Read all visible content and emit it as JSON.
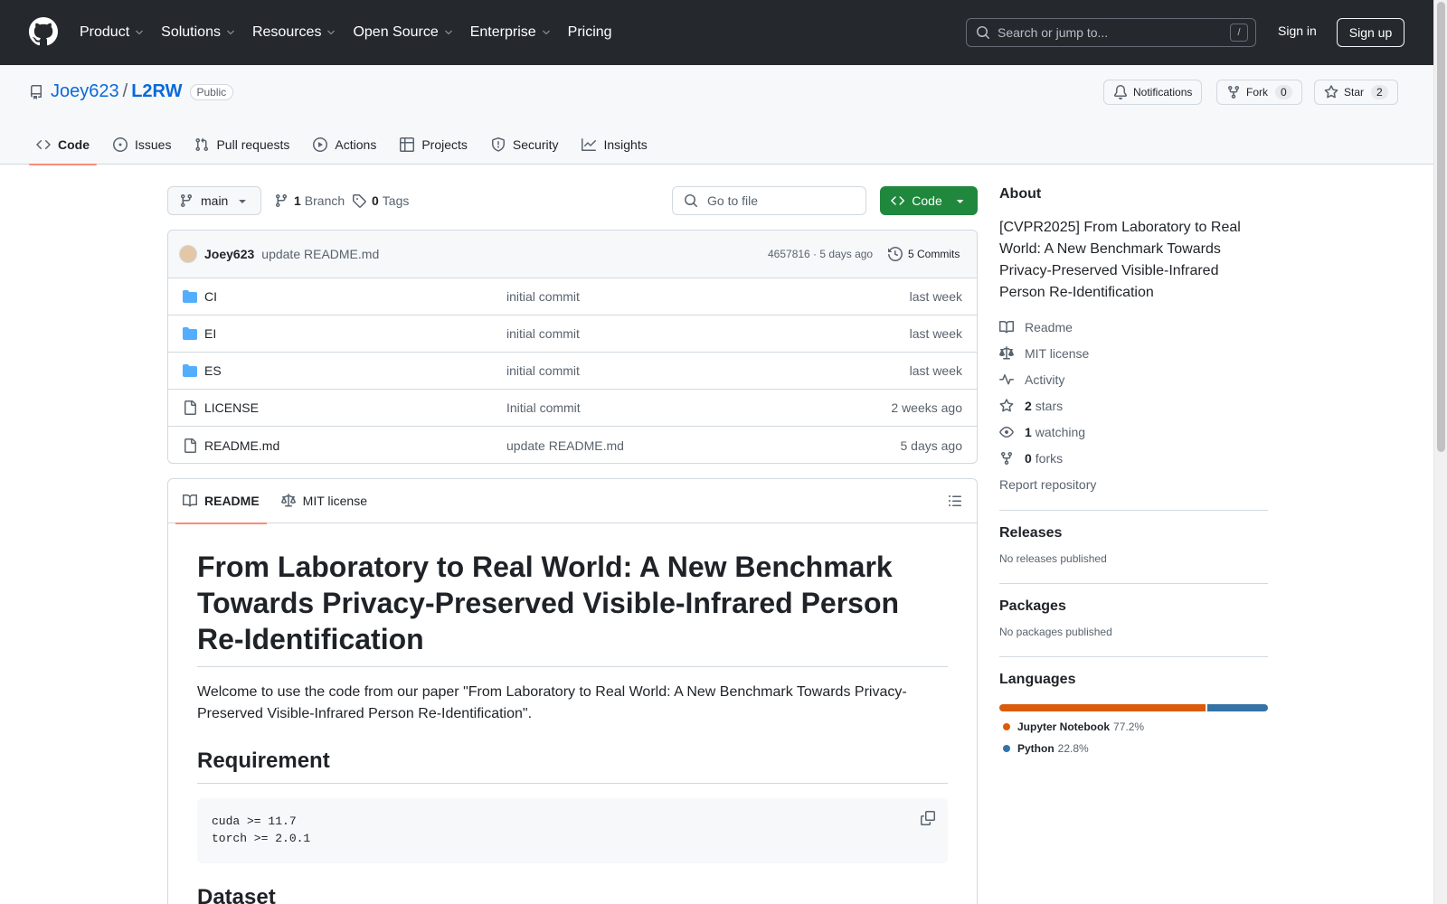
{
  "header": {
    "nav": [
      {
        "label": "Product",
        "chevron": true
      },
      {
        "label": "Solutions",
        "chevron": true
      },
      {
        "label": "Resources",
        "chevron": true
      },
      {
        "label": "Open Source",
        "chevron": true
      },
      {
        "label": "Enterprise",
        "chevron": true
      },
      {
        "label": "Pricing",
        "chevron": false
      }
    ],
    "search_placeholder": "Search or jump to...",
    "search_key": "/",
    "sign_in": "Sign in",
    "sign_up": "Sign up"
  },
  "repo": {
    "owner": "Joey623",
    "separator": "/",
    "name": "L2RW",
    "visibility": "Public",
    "notifications_label": "Notifications",
    "fork_label": "Fork",
    "fork_count": "0",
    "star_label": "Star",
    "star_count": "2",
    "tabs": [
      "Code",
      "Issues",
      "Pull requests",
      "Actions",
      "Projects",
      "Security",
      "Insights"
    ]
  },
  "toolbar": {
    "branch": "main",
    "branch_count": "1",
    "branch_label": "Branch",
    "tag_count": "0",
    "tag_label": "Tags",
    "goto_placeholder": "Go to file",
    "code_label": "Code"
  },
  "commit": {
    "author": "Joey623",
    "message": "update README.md",
    "sha_time": "4657816 · 5 days ago",
    "commits_label": "5 Commits"
  },
  "files": [
    {
      "type": "dir",
      "name": "CI",
      "message": "initial commit",
      "date": "last week"
    },
    {
      "type": "dir",
      "name": "EI",
      "message": "initial commit",
      "date": "last week"
    },
    {
      "type": "dir",
      "name": "ES",
      "message": "initial commit",
      "date": "last week"
    },
    {
      "type": "file",
      "name": "LICENSE",
      "message": "Initial commit",
      "date": "2 weeks ago"
    },
    {
      "type": "file",
      "name": "README.md",
      "message": "update README.md",
      "date": "5 days ago"
    }
  ],
  "readme": {
    "tab_readme": "README",
    "tab_license": "MIT license",
    "title": "From Laboratory to Real World: A New Benchmark Towards Privacy-Preserved Visible-Infrared Person Re-Identification",
    "intro": "Welcome to use the code from our paper \"From Laboratory to Real World: A New Benchmark Towards Privacy-Preserved Visible-Infrared Person Re-Identification\".",
    "requirement_heading": "Requirement",
    "code_lines": [
      "cuda >= 11.7",
      "torch >= 2.0.1"
    ],
    "dataset_heading": "Dataset"
  },
  "about": {
    "heading": "About",
    "description": "[CVPR2025] From Laboratory to Real World: A New Benchmark Towards Privacy-Preserved Visible-Infrared Person Re-Identification",
    "readme": "Readme",
    "license": "MIT license",
    "activity": "Activity",
    "stars_count": "2",
    "stars_label": "stars",
    "watching_count": "1",
    "watching_label": "watching",
    "forks_count": "0",
    "forks_label": "forks",
    "report": "Report repository"
  },
  "releases": {
    "heading": "Releases",
    "text": "No releases published"
  },
  "packages": {
    "heading": "Packages",
    "text": "No packages published"
  },
  "languages": {
    "heading": "Languages",
    "items": [
      {
        "name": "Jupyter Notebook",
        "percent": "77.2%",
        "value": 77.2,
        "color": "#DA5B0B"
      },
      {
        "name": "Python",
        "percent": "22.8%",
        "value": 22.8,
        "color": "#3572A5"
      }
    ]
  }
}
